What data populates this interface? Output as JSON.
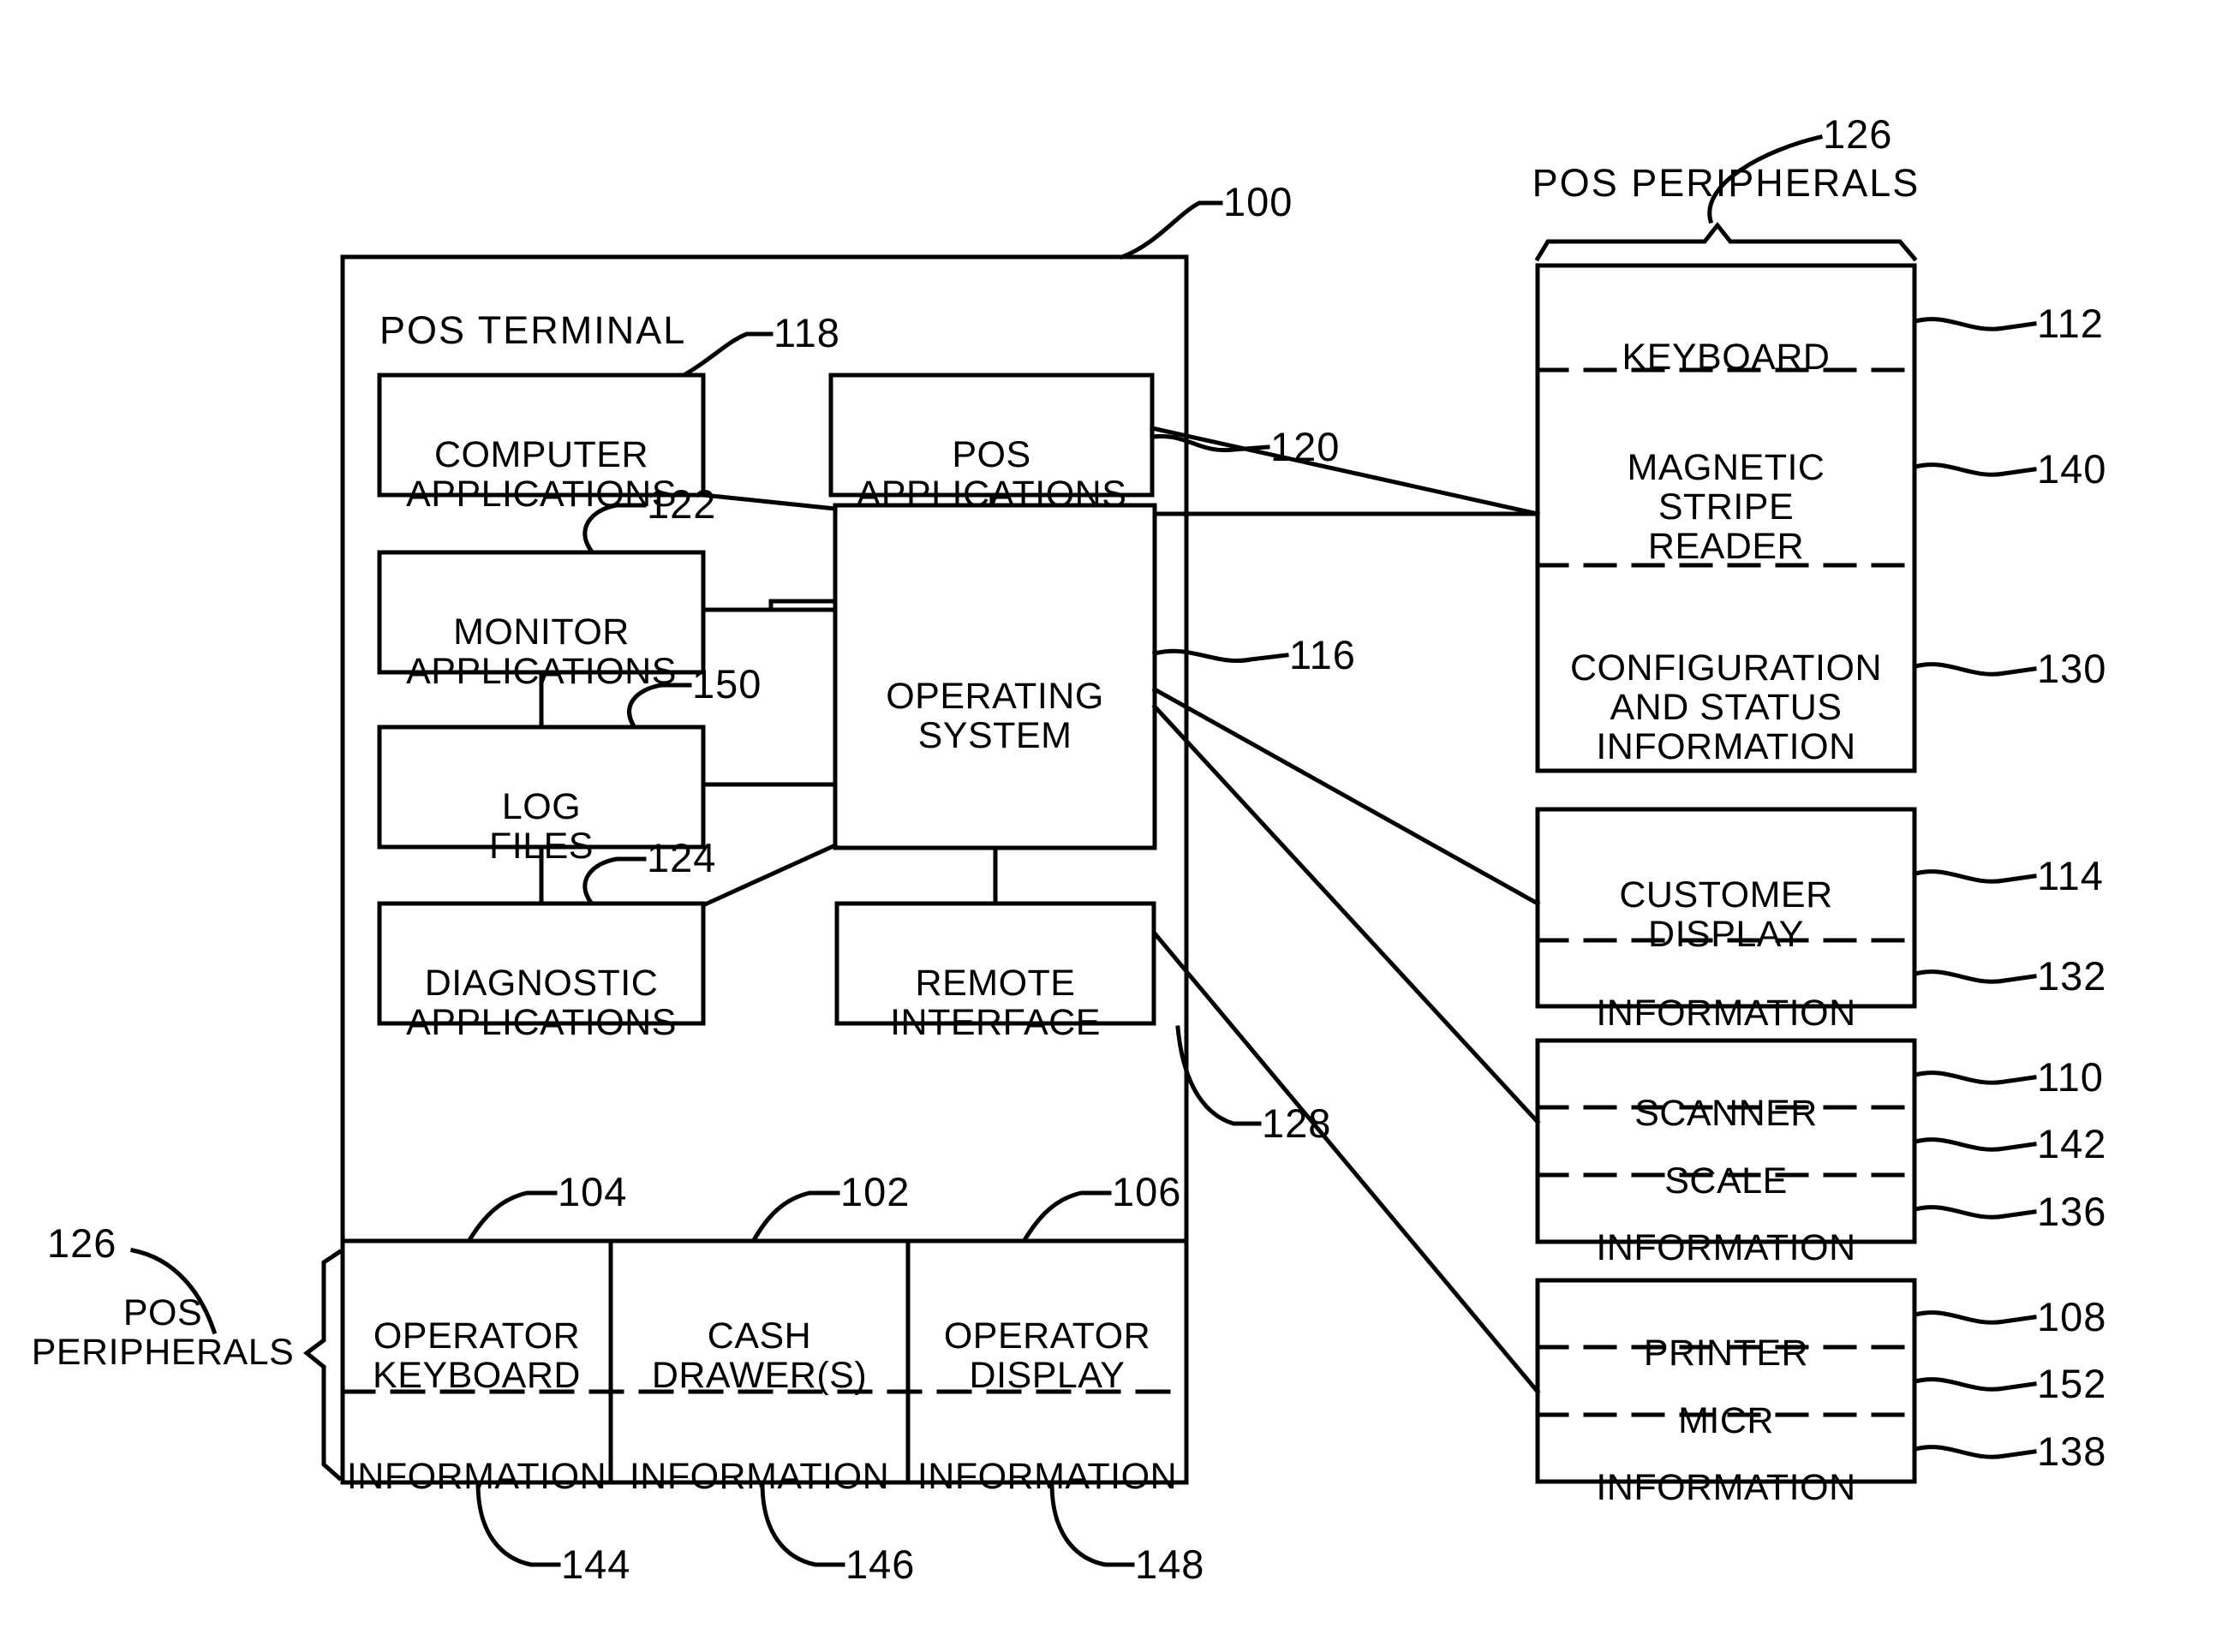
{
  "figure": {
    "type": "patent-block-diagram",
    "terminal": {
      "title": "POS  TERMINAL",
      "ref": "100",
      "blocks": [
        {
          "id": "computer-applications",
          "label": "COMPUTER\nAPPLICATIONS",
          "ref": "118"
        },
        {
          "id": "pos-applications",
          "label": "POS\nAPPLICATIONS",
          "ref": "120"
        },
        {
          "id": "monitor-applications",
          "label": "MONITOR\nAPPLICATIONS",
          "ref": "122"
        },
        {
          "id": "log-files",
          "label": "LOG\nFILES",
          "ref": "150"
        },
        {
          "id": "diagnostic-applications",
          "label": "DIAGNOSTIC\nAPPLICATIONS",
          "ref": "124"
        },
        {
          "id": "operating-system",
          "label": "OPERATING\nSYSTEM",
          "ref": "116"
        },
        {
          "id": "remote-interface",
          "label": "REMOTE\nINTERFACE",
          "ref": "128"
        }
      ]
    },
    "bottom_peripherals": {
      "group_label": "POS\nPERIPHERALS",
      "group_ref": "126",
      "columns": [
        {
          "id": "operator-keyboard",
          "label": "OPERATOR\nKEYBOARD",
          "ref": "104",
          "info_label": "INFORMATION",
          "info_ref": "144"
        },
        {
          "id": "cash-drawers",
          "label": "CASH\nDRAWER(S)",
          "ref": "102",
          "info_label": "INFORMATION",
          "info_ref": "146"
        },
        {
          "id": "operator-display",
          "label": "OPERATOR\nDISPLAY",
          "ref": "106",
          "info_label": "INFORMATION",
          "info_ref": "148"
        }
      ]
    },
    "right_peripherals": {
      "group_label": "POS  PERIPHERALS",
      "group_ref": "126",
      "groups": [
        {
          "id": "keyboard-msr-group",
          "rows": [
            {
              "id": "keyboard",
              "label": "KEYBOARD",
              "ref": "112"
            },
            {
              "id": "magnetic-stripe-reader",
              "label": "MAGNETIC\nSTRIPE\nREADER",
              "ref": "140"
            },
            {
              "id": "configuration-and-status-information",
              "label": "CONFIGURATION\nAND  STATUS\nINFORMATION",
              "ref": "130"
            }
          ]
        },
        {
          "id": "customer-display-group",
          "rows": [
            {
              "id": "customer-display",
              "label": "CUSTOMER\nDISPLAY",
              "ref": "114"
            },
            {
              "id": "customer-display-information",
              "label": "INFORMATION",
              "ref": "132"
            }
          ]
        },
        {
          "id": "scanner-scale-group",
          "rows": [
            {
              "id": "scanner",
              "label": "SCANNER",
              "ref": "110"
            },
            {
              "id": "scale",
              "label": "SCALE",
              "ref": "142"
            },
            {
              "id": "scanner-information",
              "label": "INFORMATION",
              "ref": "136"
            }
          ]
        },
        {
          "id": "printer-micr-group",
          "rows": [
            {
              "id": "printer",
              "label": "PRINTER",
              "ref": "108"
            },
            {
              "id": "micr",
              "label": "MICR",
              "ref": "152"
            },
            {
              "id": "printer-information",
              "label": "INFORMATION",
              "ref": "138"
            }
          ]
        }
      ]
    },
    "colors": {
      "ink": "#000000",
      "paper": "#ffffff"
    }
  }
}
